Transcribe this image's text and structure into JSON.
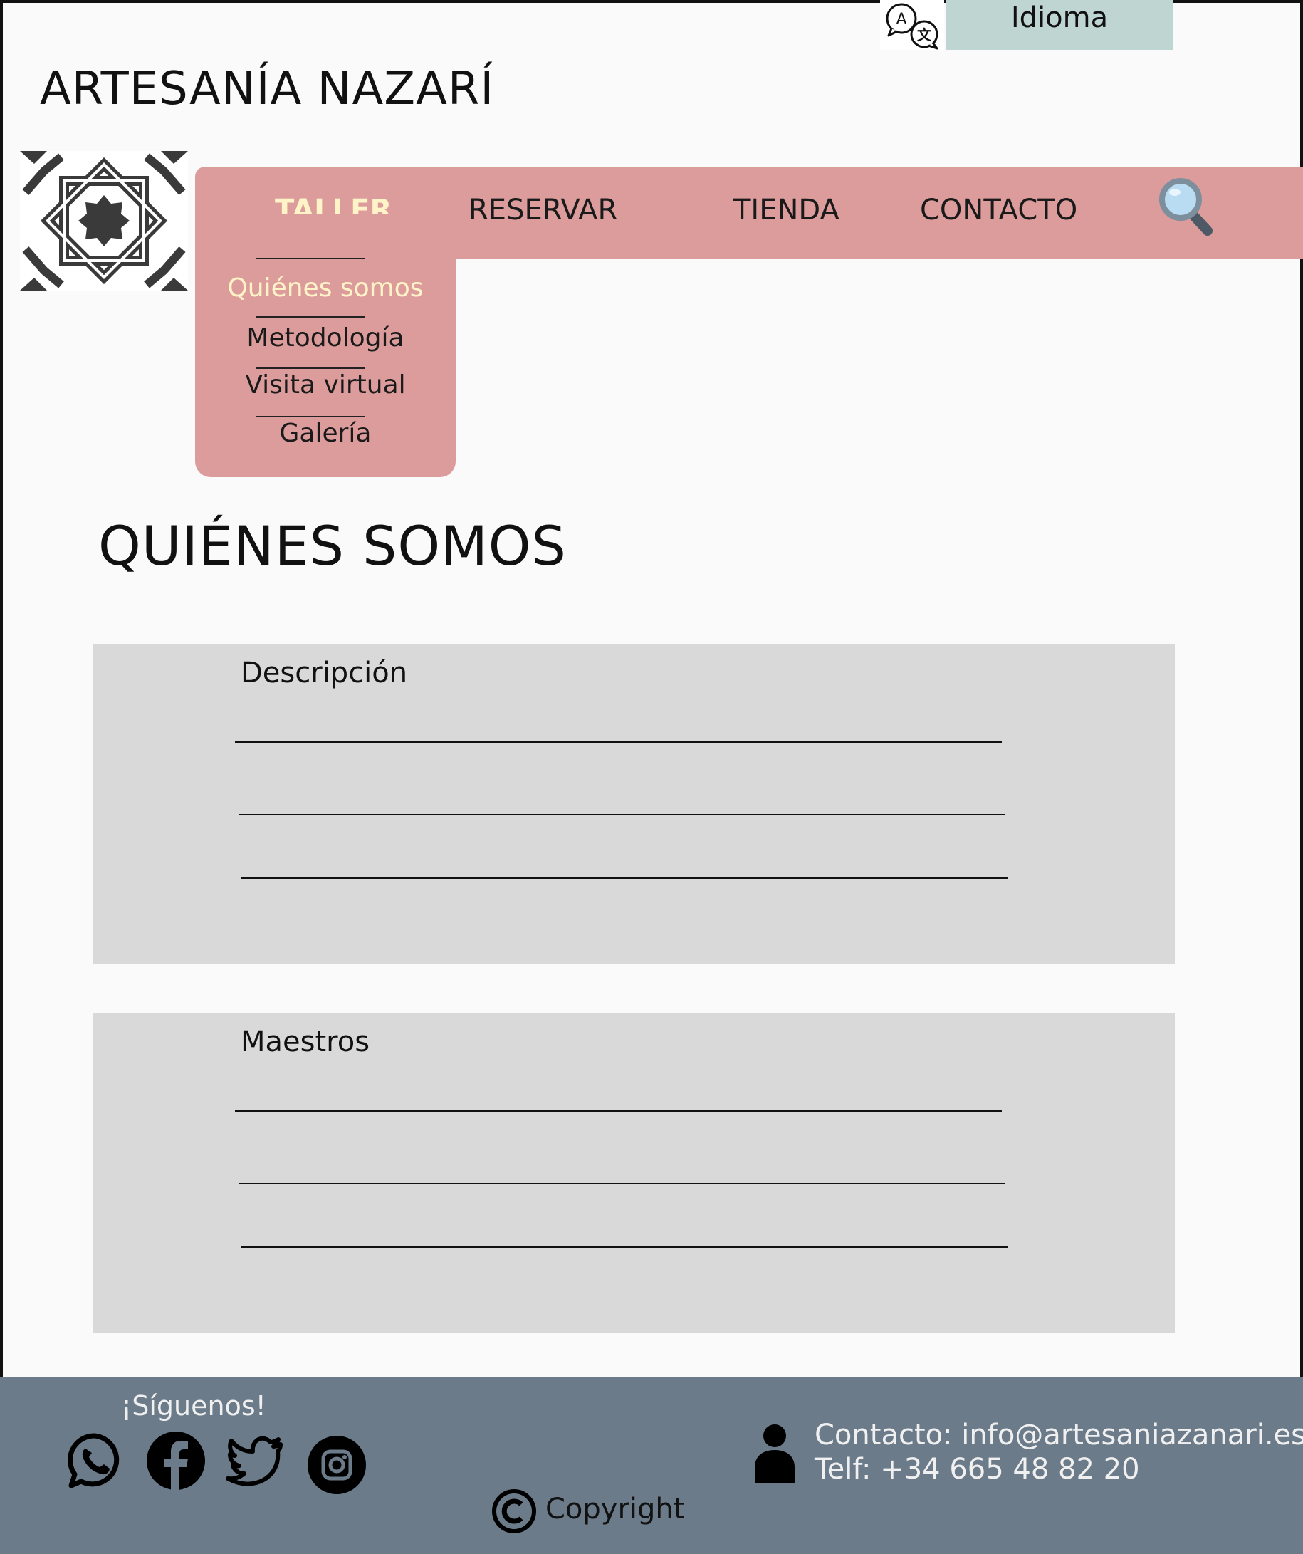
{
  "header": {
    "site_title": "ARTESANÍA NAZARÍ",
    "language_button": "Idioma"
  },
  "nav": {
    "items": [
      {
        "label": "TALLER",
        "active": true
      },
      {
        "label": "RESERVAR",
        "active": false
      },
      {
        "label": "TIENDA",
        "active": false
      },
      {
        "label": "CONTACTO",
        "active": false
      }
    ],
    "dropdown": [
      {
        "label": "Quiénes somos",
        "active": true
      },
      {
        "label": "Metodología",
        "active": false
      },
      {
        "label": "Visita virtual",
        "active": false
      },
      {
        "label": "Galería",
        "active": false
      }
    ]
  },
  "main": {
    "page_title": "QUIÉNES SOMOS",
    "sections": [
      {
        "label": "Descripción"
      },
      {
        "label": "Maestros"
      }
    ]
  },
  "footer": {
    "follow": "¡Síguenos!",
    "contact_email": "Contacto: info@artesaniazanari.es",
    "contact_phone": "Telf: +34 665 48 82 20",
    "copyright": "Copyright",
    "social_icons": [
      "whatsapp-icon",
      "facebook-icon",
      "twitter-icon",
      "instagram-icon"
    ]
  },
  "colors": {
    "nav_bg": "#dc9c9c",
    "nav_active": "#fff4c8",
    "language_bg": "#bfd5d2",
    "section_bg": "#d9d9d9",
    "footer_bg": "#6c7b8a"
  }
}
